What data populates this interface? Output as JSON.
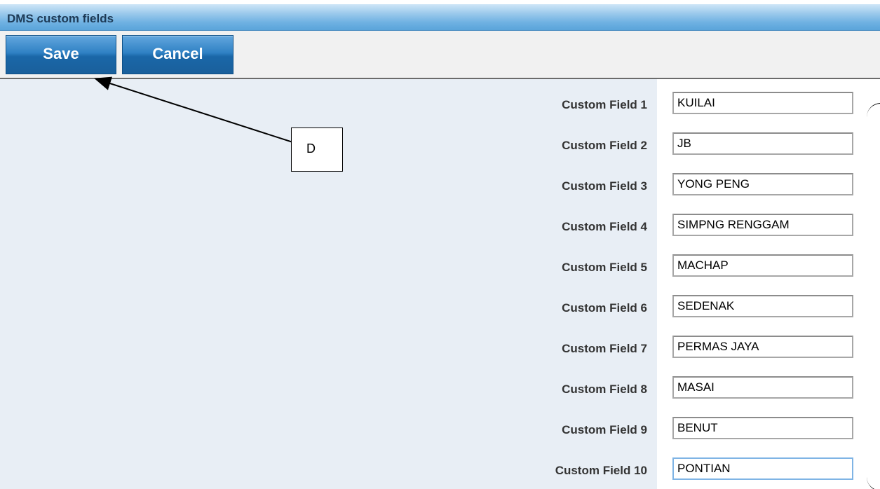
{
  "window": {
    "title": "DMS custom fields"
  },
  "toolbar": {
    "save_label": "Save",
    "cancel_label": "Cancel"
  },
  "fields": [
    {
      "label": "Custom Field 1",
      "value": "KUILAI"
    },
    {
      "label": "Custom Field 2",
      "value": "JB"
    },
    {
      "label": "Custom Field 3",
      "value": "YONG PENG"
    },
    {
      "label": "Custom Field 4",
      "value": "SIMPNG RENGGAM"
    },
    {
      "label": "Custom Field 5",
      "value": "MACHAP"
    },
    {
      "label": "Custom Field 6",
      "value": "SEDENAK"
    },
    {
      "label": "Custom Field 7",
      "value": "PERMAS JAYA"
    },
    {
      "label": "Custom Field 8",
      "value": "MASAI"
    },
    {
      "label": "Custom Field 9",
      "value": "BENUT"
    },
    {
      "label": "Custom Field 10",
      "value": "PONTIAN"
    }
  ],
  "annotation": {
    "label": "D"
  },
  "colors": {
    "title_bar": "#6fb1e2",
    "button": "#2f81c4",
    "content_bg": "#e8eef5"
  }
}
